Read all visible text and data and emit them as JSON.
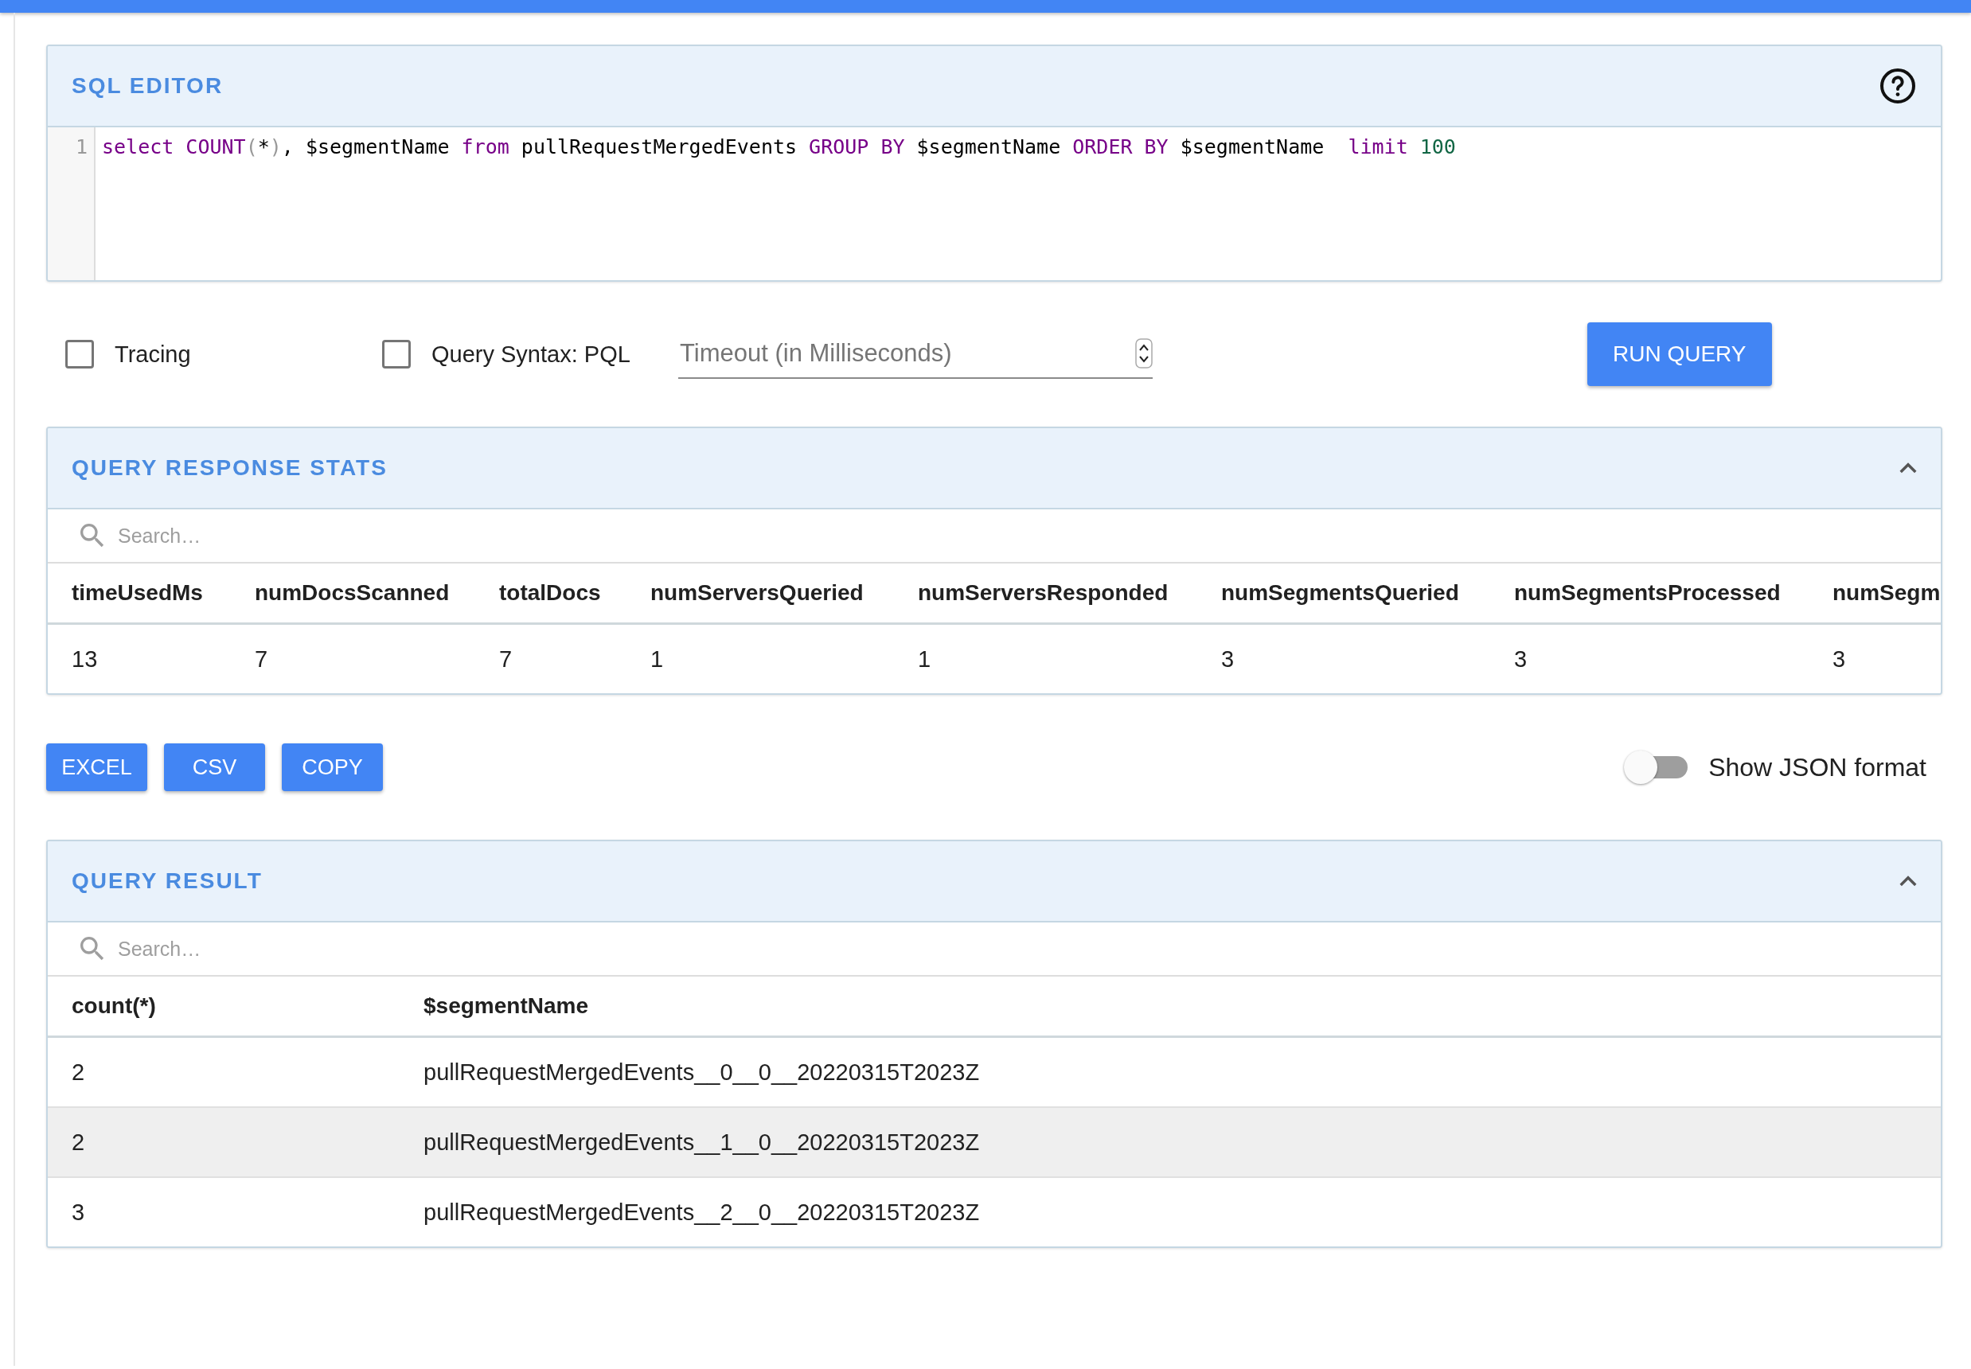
{
  "sql_editor": {
    "title": "SQL EDITOR",
    "line_number": "1",
    "tokens": [
      {
        "text": "select ",
        "kind": "keyword"
      },
      {
        "text": "COUNT",
        "kind": "keyword"
      },
      {
        "text": "(",
        "kind": "punct"
      },
      {
        "text": "*",
        "kind": "plain"
      },
      {
        "text": ")",
        "kind": "punct"
      },
      {
        "text": ", $segmentName ",
        "kind": "plain"
      },
      {
        "text": "from ",
        "kind": "keyword"
      },
      {
        "text": "pullRequestMergedEvents ",
        "kind": "plain"
      },
      {
        "text": "GROUP BY ",
        "kind": "keyword"
      },
      {
        "text": "$segmentName ",
        "kind": "plain"
      },
      {
        "text": "ORDER BY ",
        "kind": "keyword"
      },
      {
        "text": "$segmentName  ",
        "kind": "plain"
      },
      {
        "text": "limit ",
        "kind": "keyword"
      },
      {
        "text": "100",
        "kind": "number"
      }
    ]
  },
  "options": {
    "checkboxes": [
      {
        "label": "Tracing",
        "checked": false
      },
      {
        "label": "Query Syntax: PQL",
        "checked": false
      }
    ],
    "timeout": {
      "placeholder": "Timeout (in Milliseconds)"
    },
    "run_button": "RUN QUERY"
  },
  "stats": {
    "title": "QUERY RESPONSE STATS",
    "expanded": true,
    "search": {
      "placeholder": "Search…"
    },
    "columns": [
      "timeUsedMs",
      "numDocsScanned",
      "totalDocs",
      "numServersQueried",
      "numServersResponded",
      "numSegmentsQueried",
      "numSegmentsProcessed",
      "numSegm"
    ],
    "rows": [
      {
        "cells": [
          "13",
          "7",
          "7",
          "1",
          "1",
          "3",
          "3",
          "3"
        ]
      }
    ]
  },
  "export_buttons": [
    "EXCEL",
    "CSV",
    "COPY"
  ],
  "json_toggle": {
    "label": "Show JSON format",
    "on": false
  },
  "result": {
    "title": "QUERY RESULT",
    "expanded": true,
    "search": {
      "placeholder": "Search…"
    },
    "columns": [
      "count(*)",
      "$segmentName"
    ],
    "rows": [
      {
        "cells": [
          "2",
          "pullRequestMergedEvents__0__0__20220315T2023Z"
        ]
      },
      {
        "cells": [
          "2",
          "pullRequestMergedEvents__1__0__20220315T2023Z"
        ]
      },
      {
        "cells": [
          "3",
          "pullRequestMergedEvents__2__0__20220315T2023Z"
        ]
      }
    ]
  }
}
